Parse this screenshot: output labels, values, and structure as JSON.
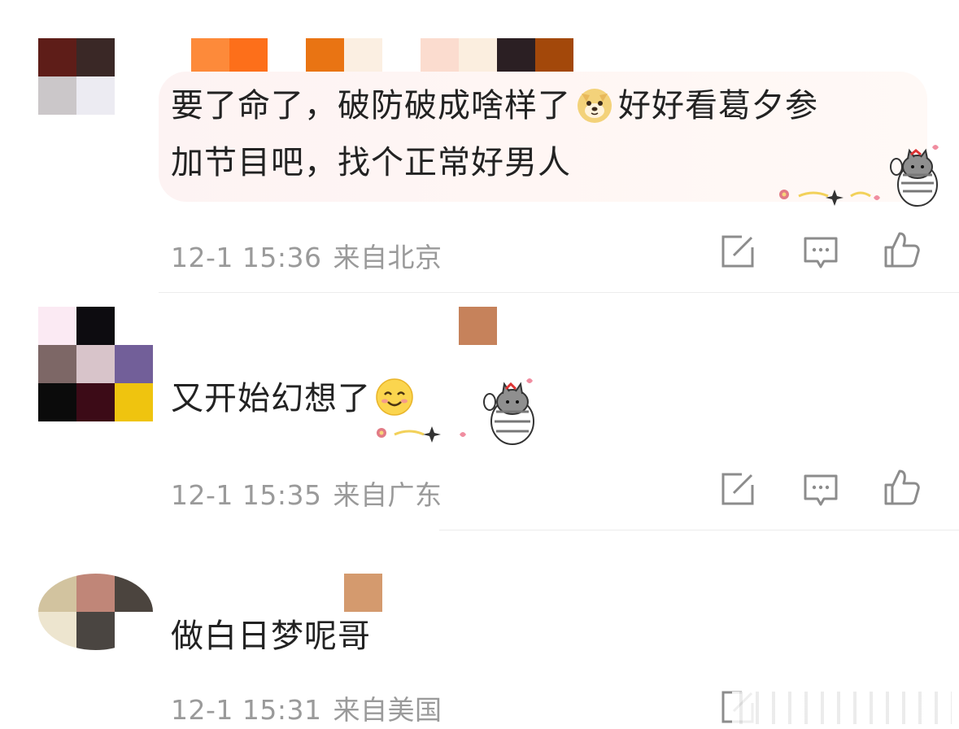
{
  "comments": [
    {
      "text_line1": "要了命了，破防破成啥样了",
      "text_line1b": "好好看葛夕参",
      "text_line2": "加节目吧，找个正常好男人",
      "emoji": "doge-emoji",
      "sticker": "cat-sticker",
      "time": "12-1 15:36",
      "location": "来自北京",
      "avatar_colors": [
        "#5e1d18",
        "#3a2826",
        "#cbc7c9",
        "#ecebf2"
      ],
      "name_colors": [
        "#fd8a3a",
        "#fd6f1a",
        "#ffffff",
        "#e97413",
        "#fbefe2",
        "#ffffff",
        "#fbdccf",
        "#fbeedf",
        "#2b1f23",
        "#a3480a"
      ]
    },
    {
      "text": "又开始幻想了",
      "emoji": "smile-emoji",
      "sticker": "cat-sticker",
      "time": "12-1 15:35",
      "location": "来自广东",
      "avatar_colors": [
        "#fbeaf3",
        "#0d0c10",
        "#ffffff",
        "#7d6766",
        "#d8c4ca",
        "#725f99",
        "#0b0b0b",
        "#3c0b17",
        "#efc40f"
      ],
      "name_colors": [
        "#c6825b"
      ]
    },
    {
      "text": "做白日梦呢哥",
      "time": "12-1 15:31",
      "location": "来自美国",
      "avatar_colors": [
        "#d2c39f",
        "#c08678",
        "#4b443e",
        "#ede5cf",
        "#4a4541",
        "#ffffff"
      ],
      "name_colors": [
        "#d49a6e"
      ]
    }
  ],
  "actions": {
    "share_icon": "share-icon",
    "comment_icon": "comment-icon",
    "like_icon": "like-icon"
  },
  "colors": {
    "text": "#222222",
    "meta": "#9a9a9a",
    "icon": "#8c8c8c",
    "bubble": "#fdf3f3"
  }
}
